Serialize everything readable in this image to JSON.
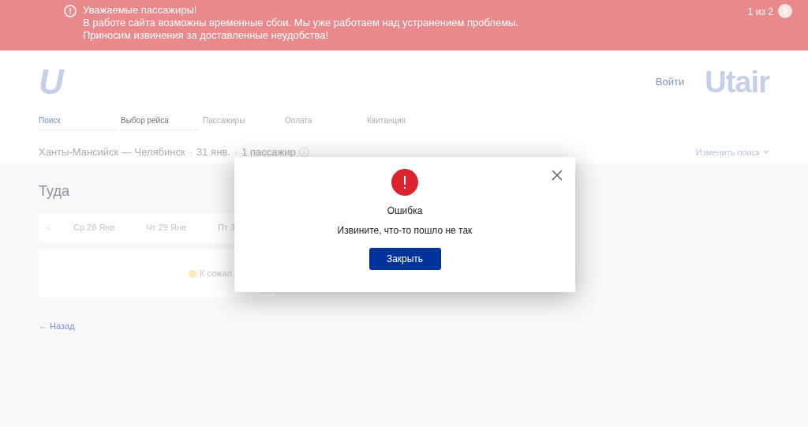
{
  "notice": {
    "title": "Уважаемые пассажиры!",
    "lines": [
      "В работе сайта возможны временные сбои. Мы уже работаем над устранением проблемы.",
      "Приносим извинения за доставленные неудобства!"
    ],
    "counter": "1 из 2"
  },
  "header": {
    "logo_mark": "U",
    "login": "Войти",
    "brand": "Utair"
  },
  "steps": [
    {
      "label": "Поиск",
      "kind": "done"
    },
    {
      "label": "Выбор рейса",
      "kind": "current"
    },
    {
      "label": "Пассажиры",
      "kind": "upcoming"
    },
    {
      "label": "Оплата",
      "kind": "upcoming"
    },
    {
      "label": "Квитанция",
      "kind": "upcoming"
    }
  ],
  "route": {
    "parts": [
      "Ханты-Мансийск — Челябинск",
      "31 янв.",
      "1 пассажир"
    ],
    "separator": "·",
    "change_search": "Изменить поиск"
  },
  "direction": "Туда",
  "dates": [
    {
      "label": "Ср 28 Янв"
    },
    {
      "label": "Чт 29 Янв"
    },
    {
      "label": "Пт 3"
    }
  ],
  "results_message": "К сожал",
  "back": "← Назад",
  "dialog": {
    "title": "Ошибка",
    "message": "Извините, что-то пошло не так",
    "button": "Закрыть"
  }
}
